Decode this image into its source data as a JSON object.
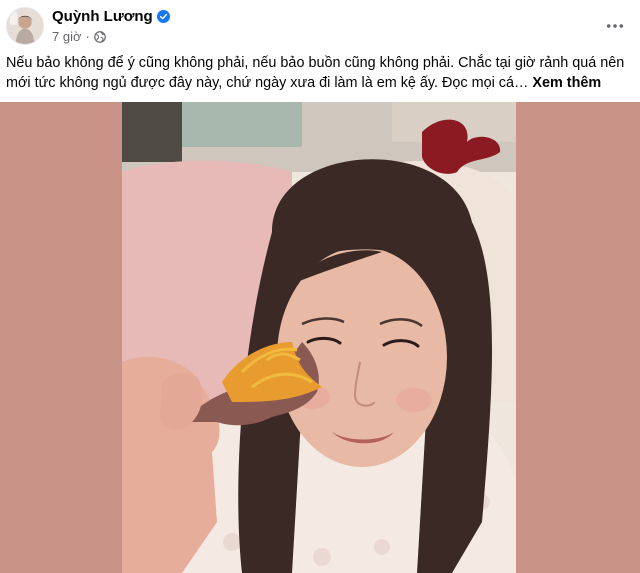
{
  "post": {
    "author": "Quỳnh Lương",
    "verified": true,
    "timestamp": "7 giờ",
    "separator": "·",
    "privacy_icon": "globe-icon",
    "more_icon": "more-horizontal-icon",
    "caption": "Nếu bảo không để ý cũng không phải, nếu bảo buồn cũng không phải. Chắc tại giờ rảnh quá nên mới tức không ngủ được đây này, chứ ngày xưa đi làm là em kệ ấy.  Đọc mọi cá…",
    "see_more": "Xem thêm"
  },
  "colors": {
    "verified_blue": "#1877f2",
    "secondary_text": "#65676b",
    "media_background": "#c99387"
  }
}
